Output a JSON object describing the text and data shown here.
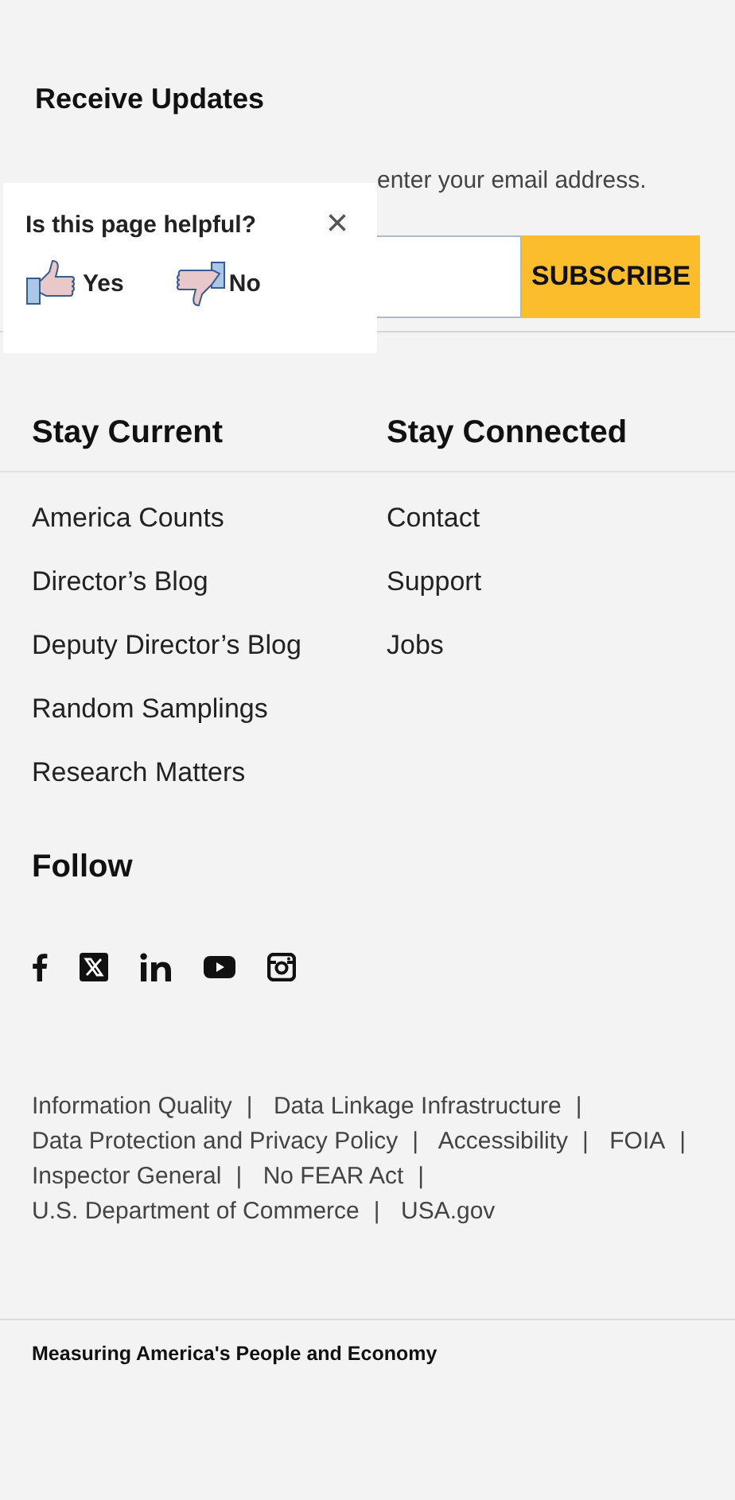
{
  "updates": {
    "title": "Receive Updates",
    "description": "enter your email address.",
    "button": "SUBSCRIBE"
  },
  "feedback": {
    "question": "Is this page helpful?",
    "close": "×",
    "options": [
      {
        "kind": "yes",
        "label": "Yes"
      },
      {
        "kind": "no",
        "label": "No"
      }
    ]
  },
  "columns": [
    {
      "title": "Stay Current",
      "links": [
        "America Counts",
        "Director’s Blog",
        "Deputy Director’s Blog",
        "Random Samplings",
        "Research Matters"
      ]
    },
    {
      "title": "Stay Connected",
      "links": [
        "Contact",
        "Support",
        "Jobs"
      ]
    }
  ],
  "follow": {
    "title": "Follow",
    "icons": [
      {
        "kind": "facebook"
      },
      {
        "kind": "x"
      },
      {
        "kind": "linkedin"
      },
      {
        "kind": "youtube"
      },
      {
        "kind": "instagram"
      }
    ]
  },
  "footer_links": {
    "separator": "|",
    "links": [
      "Information Quality",
      "Data Linkage Infrastructure",
      "Data Protection and Privacy Policy",
      "Accessibility",
      "FOIA",
      "Inspector General",
      "No FEAR Act",
      "U.S. Department of Commerce",
      "USA.gov"
    ]
  },
  "tagline": "Measuring America's People and Economy"
}
